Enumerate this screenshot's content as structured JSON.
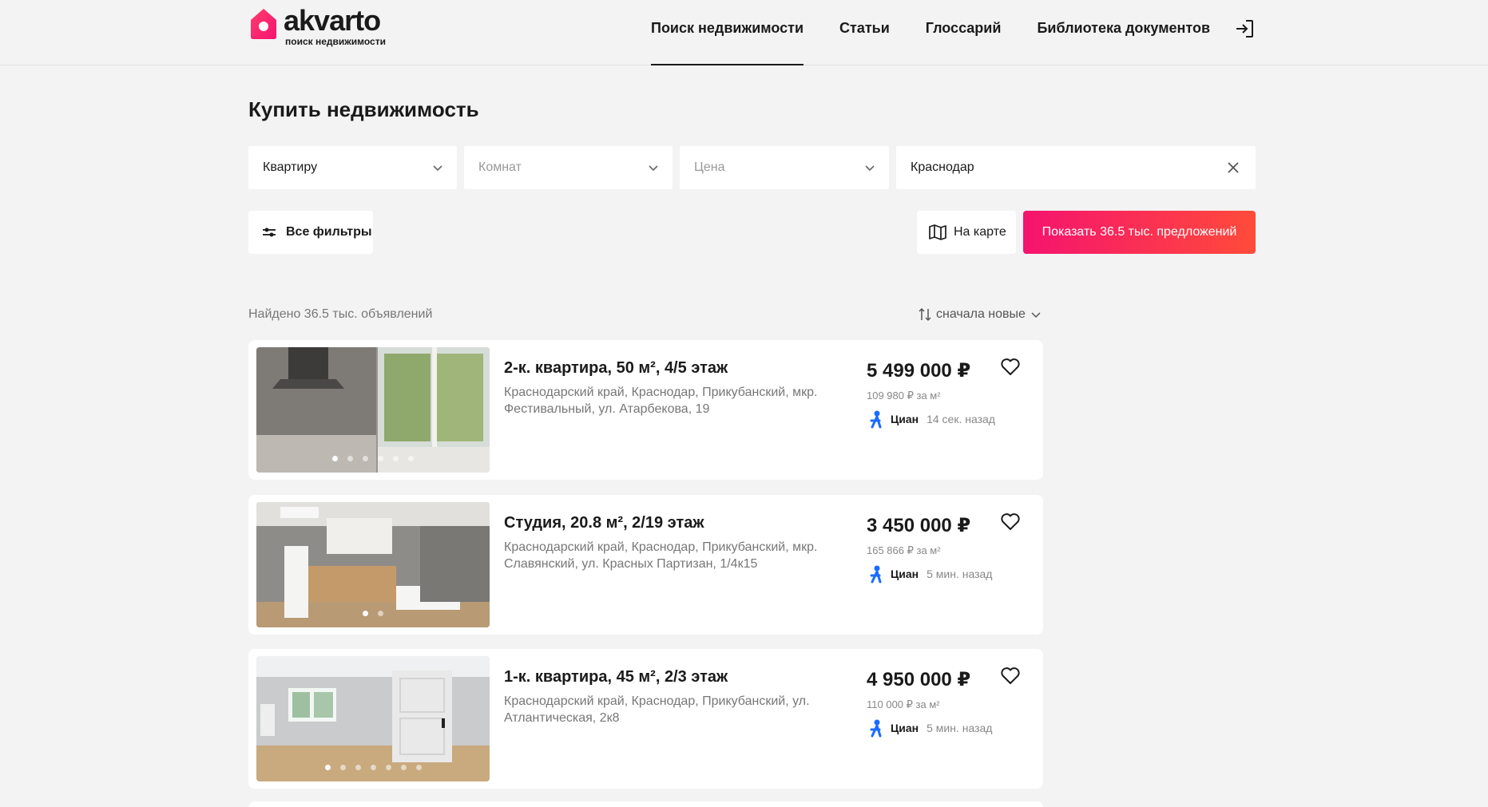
{
  "header": {
    "logo_name": "akvarto",
    "logo_sub": "поиск недвижимости",
    "nav": [
      {
        "label": "Поиск недвижимости",
        "active": true
      },
      {
        "label": "Статьи",
        "active": false
      },
      {
        "label": "Глоссарий",
        "active": false
      },
      {
        "label": "Библиотека документов",
        "active": false
      }
    ],
    "login_icon": "login-icon"
  },
  "page": {
    "title": "Купить недвижимость"
  },
  "filters": {
    "type_value": "Квартиру",
    "rooms_placeholder": "Комнат",
    "price_placeholder": "Цена",
    "city_value": "Краснодар",
    "all_filters_label": "Все фильтры",
    "map_label": "На карте",
    "show_label": "Показать 36.5 тыс. предложений"
  },
  "results": {
    "found_text": "Найдено 36.5 тыс. объявлений",
    "sort_label": "сначала новые"
  },
  "listings": [
    {
      "title": "2-к. квартира, 50 м², 4/5 этаж",
      "address": "Краснодарский край, Краснодар, Прикубанский, мкр. Фестивальный, ул. Атарбекова, 19",
      "price": "5 499 000 ₽",
      "price_per_m2": "109 980 ₽ за м²",
      "source": "Циан",
      "time": "14 сек. назад",
      "photo_count": 6,
      "active_photo": 0
    },
    {
      "title": "Студия, 20.8 м², 2/19 этаж",
      "address": "Краснодарский край, Краснодар, Прикубанский, мкр. Славянский, ул. Красных Партизан, 1/4к15",
      "price": "3 450 000 ₽",
      "price_per_m2": "165 866 ₽ за м²",
      "source": "Циан",
      "time": "5 мин. назад",
      "photo_count": 2,
      "active_photo": 0
    },
    {
      "title": "1-к. квартира, 45 м², 2/3 этаж",
      "address": "Краснодарский край, Краснодар, Прикубанский, ул. Атлантическая, 2к8",
      "price": "4 950 000 ₽",
      "price_per_m2": "110 000 ₽ за м²",
      "source": "Циан",
      "time": "5 мин. назад",
      "photo_count": 7,
      "active_photo": 0
    }
  ],
  "colors": {
    "brand_pink": "#f5136f",
    "brand_orange": "#ff4b3a",
    "cian_blue": "#1a6cff"
  }
}
